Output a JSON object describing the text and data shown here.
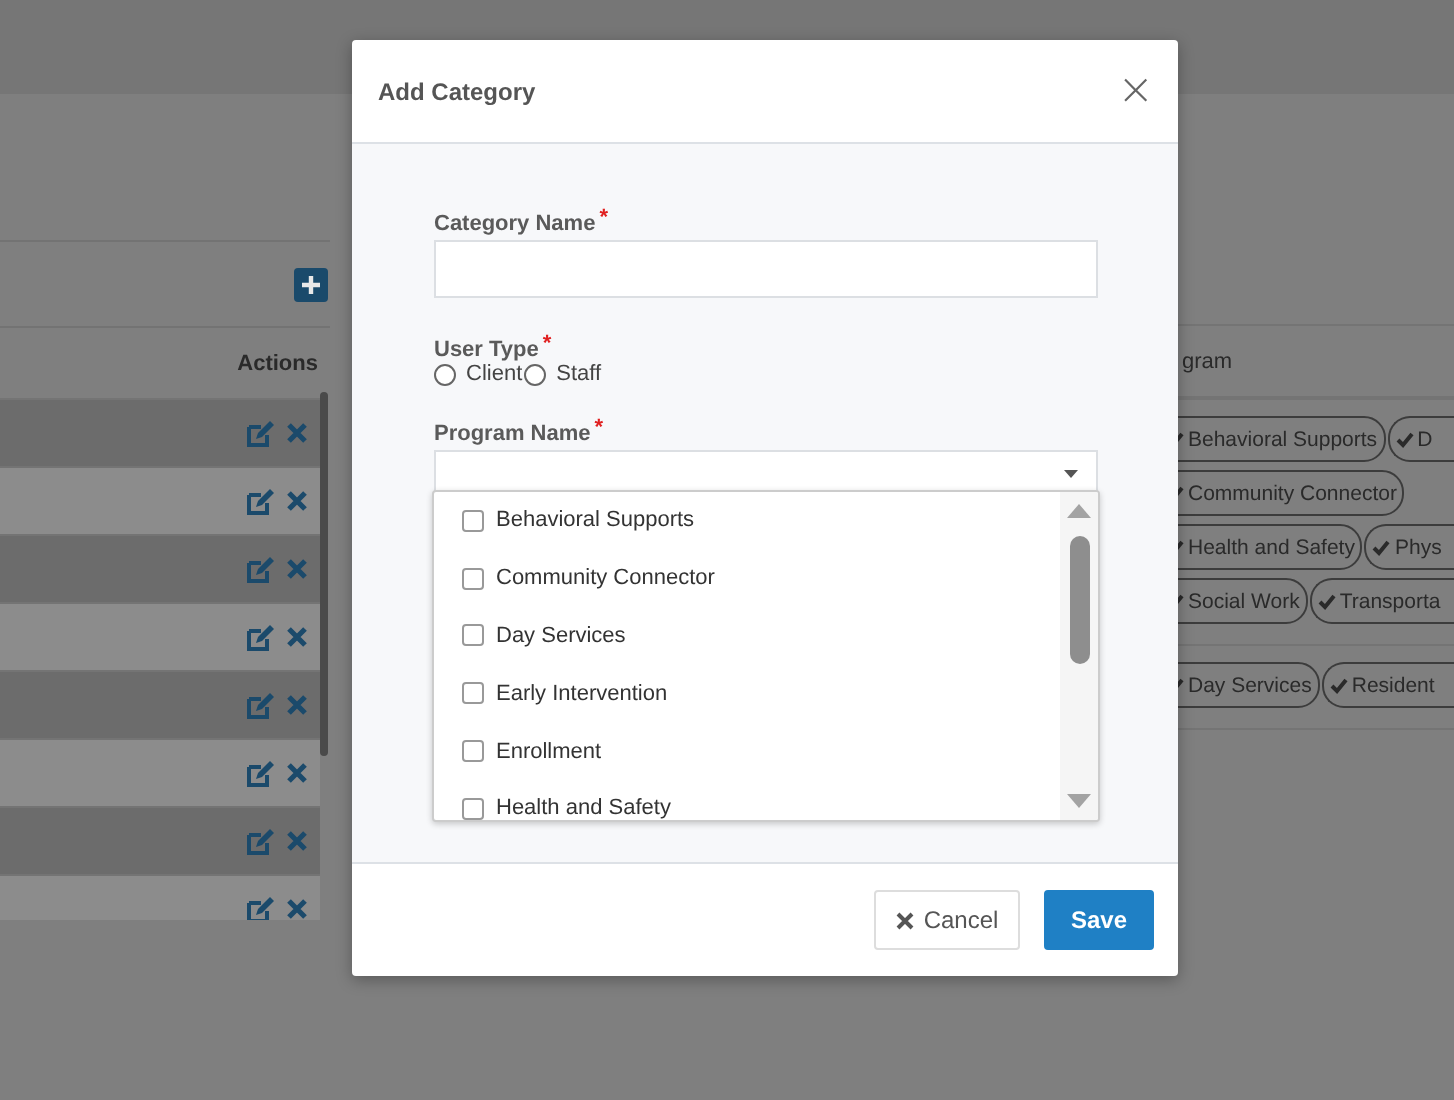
{
  "background": {
    "actions_header": "Actions",
    "action_rows": [
      {
        "shaded": true
      },
      {
        "shaded": false
      },
      {
        "shaded": true
      },
      {
        "shaded": false
      },
      {
        "shaded": true
      },
      {
        "shaded": false
      },
      {
        "shaded": true
      },
      {
        "shaded": false
      }
    ],
    "program_header": "gram",
    "program_cells": [
      [
        [
          "Behavioral Supports",
          "D"
        ],
        [
          "Community Connector"
        ],
        [
          "Health and Safety",
          "Phys"
        ],
        [
          "Social Work",
          "Transporta"
        ]
      ],
      [
        [
          "Day Services",
          "Resident"
        ]
      ]
    ]
  },
  "dialog": {
    "title": "Add Category",
    "close": "×",
    "category_name": {
      "label": "Category Name",
      "required_mark": "*"
    },
    "user_type": {
      "label": "User Type",
      "required_mark": "*",
      "options": [
        {
          "label": "Client",
          "selected": false
        },
        {
          "label": "Staff",
          "selected": false
        }
      ]
    },
    "program_name": {
      "label": "Program Name",
      "required_mark": "*",
      "expanded": true,
      "options": [
        {
          "label": "Behavioral Supports",
          "checked": false
        },
        {
          "label": "Community Connector",
          "checked": false
        },
        {
          "label": "Day Services",
          "checked": false
        },
        {
          "label": "Early Intervention",
          "checked": false
        },
        {
          "label": "Enrollment",
          "checked": false
        },
        {
          "label": "Health and Safety",
          "checked": false
        }
      ]
    },
    "buttons": [
      {
        "kind": "cancel",
        "label": "Cancel"
      },
      {
        "kind": "save",
        "label": "Save"
      }
    ]
  }
}
